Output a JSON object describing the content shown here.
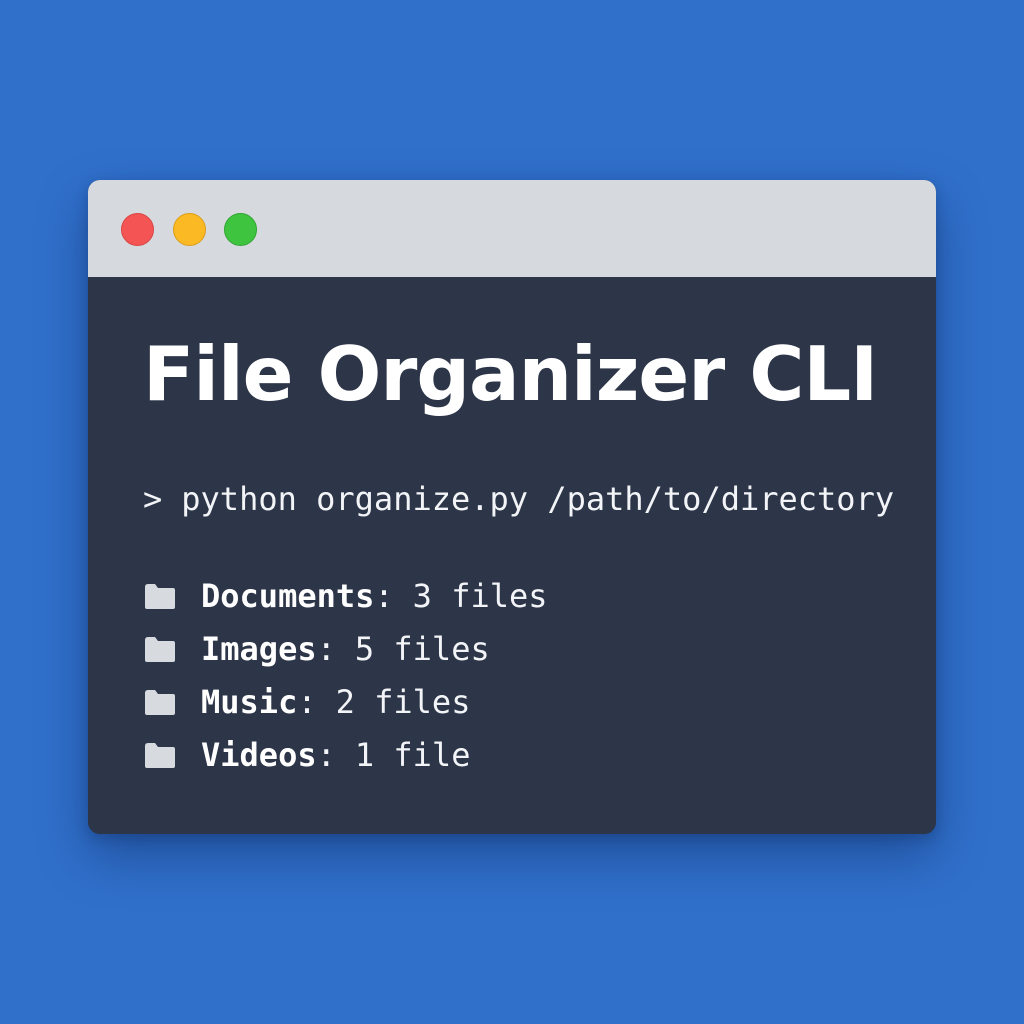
{
  "window": {
    "controls": [
      "close",
      "minimize",
      "maximize"
    ]
  },
  "terminal": {
    "title": "File Organizer CLI",
    "prompt": ">",
    "command": "python organize.py /path/to/directory",
    "output": [
      {
        "icon": "folder-icon",
        "name": "Documents",
        "separator": ":",
        "count": "3 files"
      },
      {
        "icon": "folder-icon",
        "name": "Images",
        "separator": ":",
        "count": "5 files"
      },
      {
        "icon": "folder-icon",
        "name": "Music",
        "separator": ":",
        "count": "2 files"
      },
      {
        "icon": "folder-icon",
        "name": "Videos",
        "separator": ":",
        "count": "1 file"
      }
    ]
  },
  "colors": {
    "background": "#3070cb",
    "titlebar": "#d6d9dd",
    "terminal": "#2d3649",
    "close": "#f45454",
    "minimize": "#fbb923",
    "maximize": "#3fc440",
    "text": "#ffffff"
  }
}
